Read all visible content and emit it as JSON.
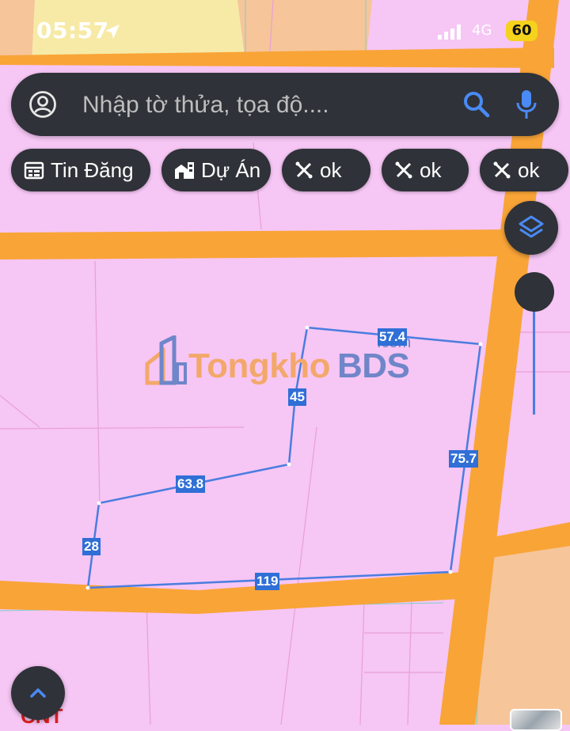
{
  "status_bar": {
    "time": "05:57",
    "network": "4G",
    "battery": "60"
  },
  "search": {
    "placeholder": "Nhập tờ thửa, tọa độ...."
  },
  "chips": [
    {
      "label": "Tin Đăng",
      "icon": "calendar-icon"
    },
    {
      "label": "Dự Án",
      "icon": "buildings-icon"
    },
    {
      "label": "ok",
      "icon": "ruler-pencil-icon"
    },
    {
      "label": "ok",
      "icon": "ruler-pencil-icon"
    },
    {
      "label": "ok",
      "icon": "ruler-pencil-icon"
    }
  ],
  "map": {
    "edge_labels": [
      "57.4",
      "45",
      "75.7",
      "63.8",
      "28",
      "119"
    ],
    "zone_label": "CNT"
  },
  "watermark": {
    "name_part1": "Tongkho",
    "name_part2": "BDS",
    "suffix": ".com"
  },
  "colors": {
    "land_pink": "#f6c6f4",
    "road_orange": "#f9a437",
    "parcel_blue": "#4a7de0",
    "ui_dark": "#2f3238",
    "yellow_zone": "#f7eaa6",
    "orange_zone": "#f6c59a"
  },
  "icons": {
    "layers": "layers-icon",
    "zoom_up": "chevron-up-icon",
    "search": "search-icon",
    "mic": "mic-icon",
    "profile": "profile-icon",
    "location": "location-arrow-icon"
  }
}
